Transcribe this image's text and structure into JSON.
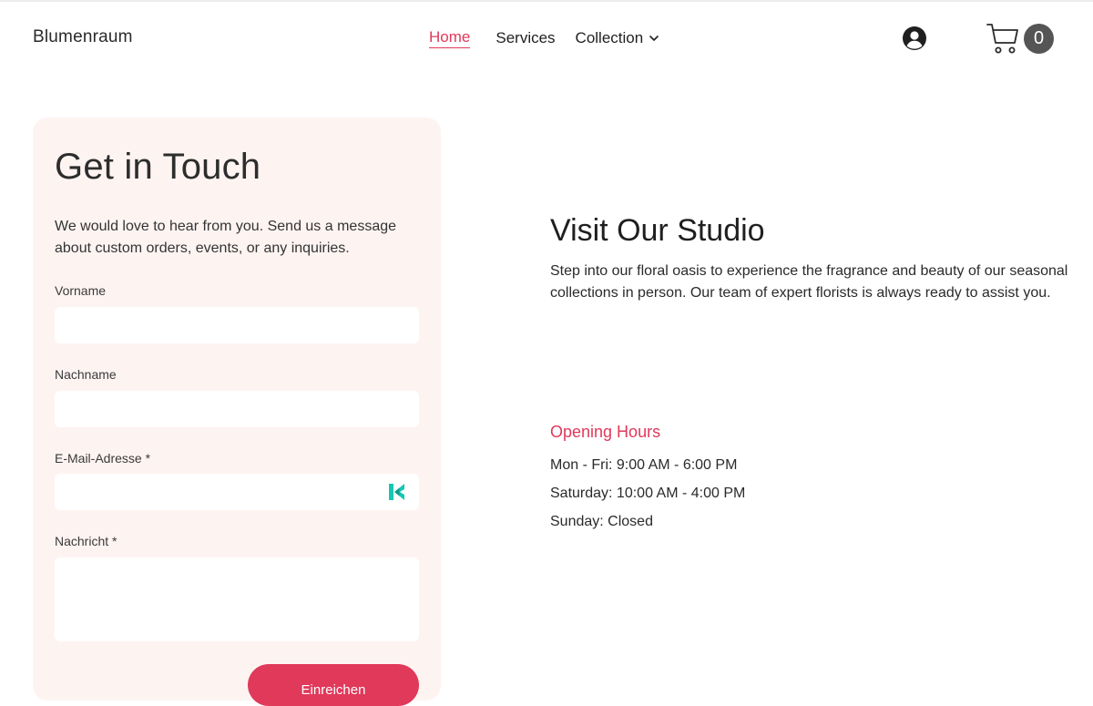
{
  "header": {
    "brand": "Blumenraum",
    "nav": {
      "home": "Home",
      "services": "Services",
      "collection": "Collection"
    },
    "account_icon": "user-circle-icon",
    "cart": {
      "icon": "shopping-cart-icon",
      "count": "0"
    }
  },
  "contact": {
    "title": "Get in Touch",
    "intro": "We would love to hear from you. Send us a message about custom orders, events, or any inquiries.",
    "fields": {
      "first_name": {
        "label": "Vorname",
        "value": ""
      },
      "last_name": {
        "label": "Nachname",
        "value": ""
      },
      "email": {
        "label": "E-Mail-Adresse *",
        "value": ""
      },
      "message": {
        "label": "Nachricht *",
        "value": ""
      }
    },
    "submit_label": "Einreichen"
  },
  "studio": {
    "title": "Visit Our Studio",
    "text": "Step into our floral oasis to experience the fragrance and beauty of our seasonal collections in person. Our team of expert florists is always ready to assist you.",
    "hours_title": "Opening Hours",
    "hours": [
      "Mon - Fri: 9:00 AM - 6:00 PM",
      "Saturday: 10:00 AM - 4:00 PM",
      "Sunday: Closed"
    ]
  },
  "colors": {
    "accent": "#e0395a",
    "card_background": "#fdf4f2",
    "cart_badge": "#555555"
  }
}
